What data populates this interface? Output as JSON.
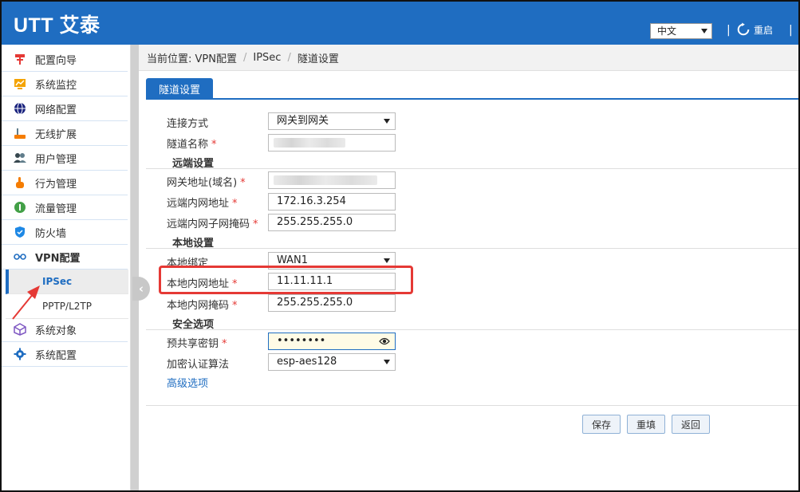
{
  "header": {
    "logo": "UTT 艾泰",
    "lang": "中文",
    "restart_label": "重启",
    "separator": "|"
  },
  "sidebar": {
    "items": [
      {
        "label": "配置向导",
        "icon": "pin-icon",
        "color": "#e53935"
      },
      {
        "label": "系统监控",
        "icon": "monitor-chart-icon",
        "color": "#f4a300"
      },
      {
        "label": "网络配置",
        "icon": "globe-icon",
        "color": "#1a237e"
      },
      {
        "label": "无线扩展",
        "icon": "router-icon",
        "color": "#f57c00"
      },
      {
        "label": "用户管理",
        "icon": "users-icon",
        "color": "#37474f"
      },
      {
        "label": "行为管理",
        "icon": "hand-icon",
        "color": "#f57c00"
      },
      {
        "label": "流量管理",
        "icon": "traffic-icon",
        "color": "#43a047"
      },
      {
        "label": "防火墙",
        "icon": "shield-icon",
        "color": "#1e88e5"
      },
      {
        "label": "VPN配置",
        "icon": "vpn-icon",
        "color": "#1f6dc1"
      }
    ],
    "sub_items": [
      {
        "label": "IPSec",
        "active": true
      },
      {
        "label": "PPTP/L2TP",
        "active": false
      }
    ],
    "items_after": [
      {
        "label": "系统对象",
        "icon": "cube-icon",
        "color": "#7e57c2"
      },
      {
        "label": "系统配置",
        "icon": "gear-icon",
        "color": "#1f6dc1"
      }
    ]
  },
  "breadcrumb": {
    "prefix": "当前位置: VPN配置",
    "level2": "IPSec",
    "level3": "隧道设置",
    "separator": "/"
  },
  "tab": {
    "label": "隧道设置"
  },
  "form": {
    "connection_mode": {
      "label": "连接方式",
      "value": "网关到网关"
    },
    "tunnel_name": {
      "label": "隧道名称",
      "required": "*"
    },
    "remote_section": "远端设置",
    "gateway_addr": {
      "label": "网关地址(域名)",
      "required": "*"
    },
    "remote_lan": {
      "label": "远端内网地址",
      "required": "*",
      "value": "172.16.3.254"
    },
    "remote_mask": {
      "label": "远端内网子网掩码",
      "required": "*",
      "value": "255.255.255.0"
    },
    "local_section": "本地设置",
    "local_bind": {
      "label": "本地绑定",
      "value": "WAN1"
    },
    "local_lan": {
      "label": "本地内网地址",
      "required": "*",
      "value": "11.11.11.1"
    },
    "local_mask": {
      "label": "本地内网掩码",
      "required": "*",
      "value": "255.255.255.0"
    },
    "security_section": "安全选项",
    "psk": {
      "label": "预共享密钥",
      "required": "*",
      "value": "••••••••"
    },
    "encryption": {
      "label": "加密认证算法",
      "value": "esp-aes128"
    },
    "advanced_link": "高级选项"
  },
  "buttons": {
    "save": "保存",
    "reset": "重填",
    "back": "返回"
  },
  "colors": {
    "brand": "#1f6dc1",
    "highlight": "#e53935",
    "required": "#e53935"
  }
}
